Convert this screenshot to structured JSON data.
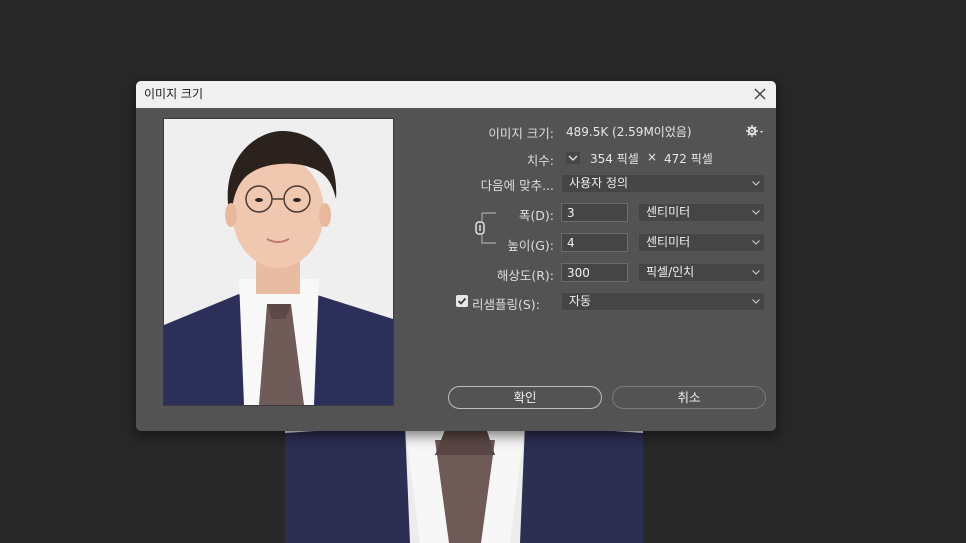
{
  "dialog": {
    "title": "이미지 크기",
    "image_size_label": "이미지 크기:",
    "image_size_value": "489.5K (2.59M이었음)",
    "dimensions_label": "치수:",
    "dimensions_width": "354 픽셀",
    "dimensions_x": "×",
    "dimensions_height": "472 픽셀",
    "fit_to_label": "다음에 맞추...",
    "fit_to_value": "사용자 정의",
    "width_label": "폭(D):",
    "width_value": "3",
    "width_unit": "센티미터",
    "height_label": "높이(G):",
    "height_value": "4",
    "height_unit": "센티미터",
    "resolution_label": "해상도(R):",
    "resolution_value": "300",
    "resolution_unit": "픽셀/인치",
    "resample_label": "리샘플링(S):",
    "resample_checked": true,
    "resample_value": "자동",
    "ok_label": "확인",
    "cancel_label": "취소"
  },
  "icons": {
    "settings": "gear-icon",
    "link": "chain-link-icon",
    "close": "close-icon",
    "dimensions_toggle": "chevron-down-icon"
  },
  "colors": {
    "background": "#282828",
    "dialog": "#535353",
    "titlebar": "#f0f0f0"
  }
}
